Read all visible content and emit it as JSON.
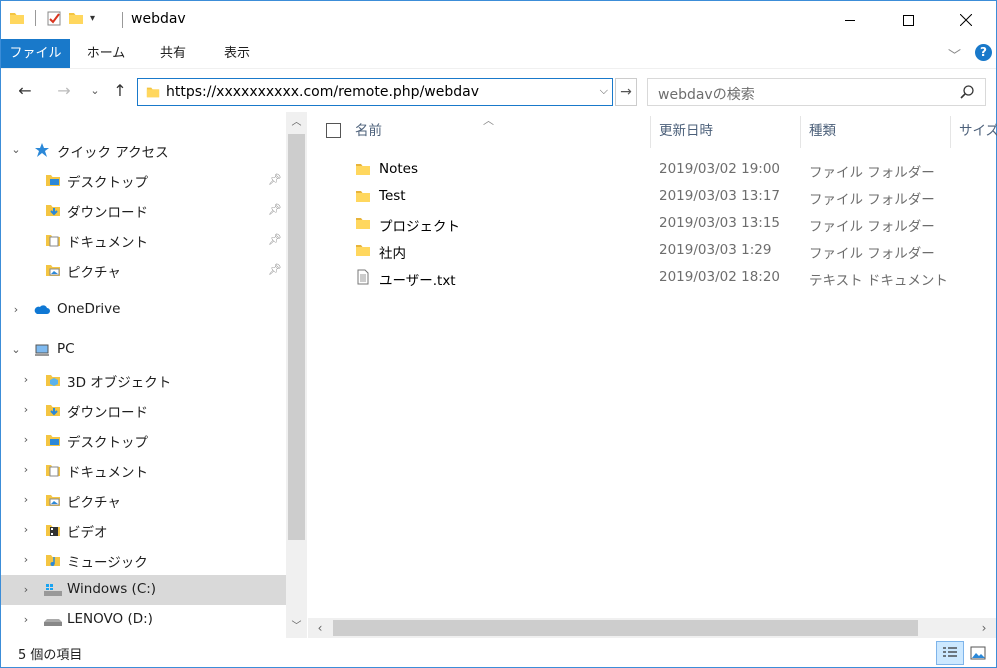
{
  "window": {
    "title": "webdav"
  },
  "ribbon": {
    "tabs": [
      "ファイル",
      "ホーム",
      "共有",
      "表示"
    ],
    "help_label": "?"
  },
  "navigation": {
    "address": "https://xxxxxxxxxx.com/remote.php/webdav",
    "search_placeholder": "webdavの検索"
  },
  "nav_pane": {
    "quick_access": "クイック アクセス",
    "quick_items": [
      "デスクトップ",
      "ダウンロード",
      "ドキュメント",
      "ピクチャ"
    ],
    "onedrive": "OneDrive",
    "pc": "PC",
    "pc_items": [
      "3D オブジェクト",
      "ダウンロード",
      "デスクトップ",
      "ドキュメント",
      "ピクチャ",
      "ビデオ",
      "ミュージック",
      "Windows (C:)",
      "LENOVO (D:)"
    ]
  },
  "columns": {
    "name": "名前",
    "date": "更新日時",
    "type": "種類",
    "size": "サイズ"
  },
  "files": [
    {
      "name": "Notes",
      "date": "2019/03/02 19:00",
      "type": "ファイル フォルダー",
      "icon": "folder-icon"
    },
    {
      "name": "Test",
      "date": "2019/03/03 13:17",
      "type": "ファイル フォルダー",
      "icon": "folder-icon"
    },
    {
      "name": "プロジェクト",
      "date": "2019/03/03 13:15",
      "type": "ファイル フォルダー",
      "icon": "folder-icon"
    },
    {
      "name": "社内",
      "date": "2019/03/03 1:29",
      "type": "ファイル フォルダー",
      "icon": "folder-icon"
    },
    {
      "name": "ユーザー.txt",
      "date": "2019/03/02 18:20",
      "type": "テキスト ドキュメント",
      "icon": "text-file-icon"
    }
  ],
  "status": {
    "item_count": "5 個の項目"
  },
  "colors": {
    "accent": "#1979ca",
    "folder": "#f4c542",
    "selected": "#d9d9d9"
  }
}
